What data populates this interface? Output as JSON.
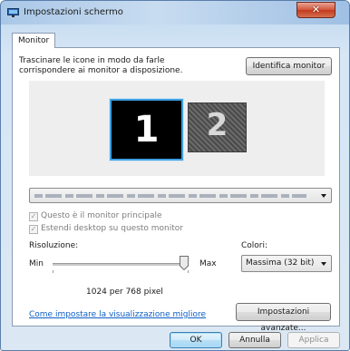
{
  "window": {
    "title": "Impostazioni schermo",
    "close_label": "✕"
  },
  "tabs": [
    {
      "label": "Monitor"
    }
  ],
  "monitor_tab": {
    "instructions": "Trascinare le icone in modo da farle corrispondere ai monitor a disposizione.",
    "identify_button": "Identifica monitor",
    "monitors": [
      {
        "number": "1",
        "selected": true
      },
      {
        "number": "2",
        "selected": false
      }
    ],
    "monitor_select_value": "",
    "checkboxes": [
      {
        "label": "Questo è il monitor principale",
        "checked": true,
        "enabled": false
      },
      {
        "label": "Estendi desktop su questo monitor",
        "checked": true,
        "enabled": false
      }
    ],
    "resolution": {
      "label": "Risoluzione:",
      "min_label": "Min",
      "max_label": "Max",
      "slider_position_fraction": 1.0,
      "value_text": "1024 per 768 pixel"
    },
    "colors": {
      "label": "Colori:",
      "selected": "Massima (32 bit)"
    },
    "help_link": "Come impostare la visualizzazione migliore",
    "advanced_button": "Impostazioni avanzate..."
  },
  "footer": {
    "ok": "OK",
    "cancel": "Annulla",
    "apply": "Applica"
  },
  "colors": {
    "accent_blue": "#3fa0e0",
    "link_blue": "#0f5fc5",
    "close_red": "#c23a1f"
  },
  "icons": {
    "app_icon": "display-settings-icon",
    "close_icon": "close-icon",
    "dropdown_icon": "chevron-down-icon",
    "check_icon": "checkmark-icon"
  }
}
